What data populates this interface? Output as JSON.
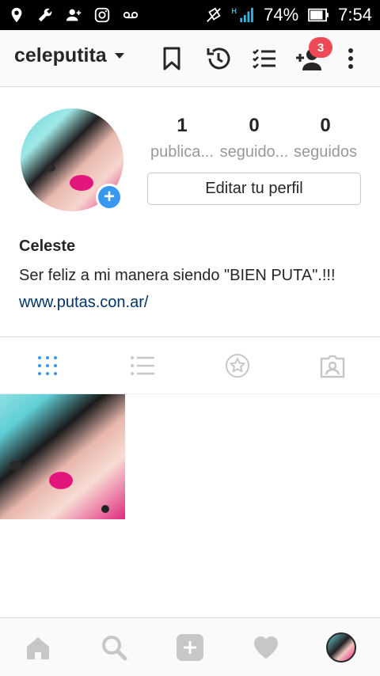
{
  "status_bar": {
    "battery": "74%",
    "time": "7:54",
    "network": "H"
  },
  "header": {
    "username": "celeputita",
    "notifications_count": "3"
  },
  "profile": {
    "stats": [
      {
        "value": "1",
        "label": "publica..."
      },
      {
        "value": "0",
        "label": "seguido..."
      },
      {
        "value": "0",
        "label": "seguidos"
      }
    ],
    "edit_button": "Editar tu perfil",
    "name": "Celeste",
    "bio": "Ser feliz a mi manera siendo \"BIEN PUTA\".!!!",
    "website": "www.putas.con.ar/"
  },
  "tabs": [
    {
      "icon": "grid-icon",
      "active": true
    },
    {
      "icon": "list-icon",
      "active": false
    },
    {
      "icon": "star-icon",
      "active": false
    },
    {
      "icon": "tagged-icon",
      "active": false
    }
  ],
  "bottom_nav": [
    {
      "icon": "home-icon"
    },
    {
      "icon": "search-icon"
    },
    {
      "icon": "add-post-icon"
    },
    {
      "icon": "heart-icon"
    },
    {
      "icon": "profile-avatar-icon"
    }
  ],
  "colors": {
    "accent": "#3897f0",
    "badge": "#ed4956",
    "link": "#003569",
    "inactive_icon": "#c7c7c7"
  }
}
